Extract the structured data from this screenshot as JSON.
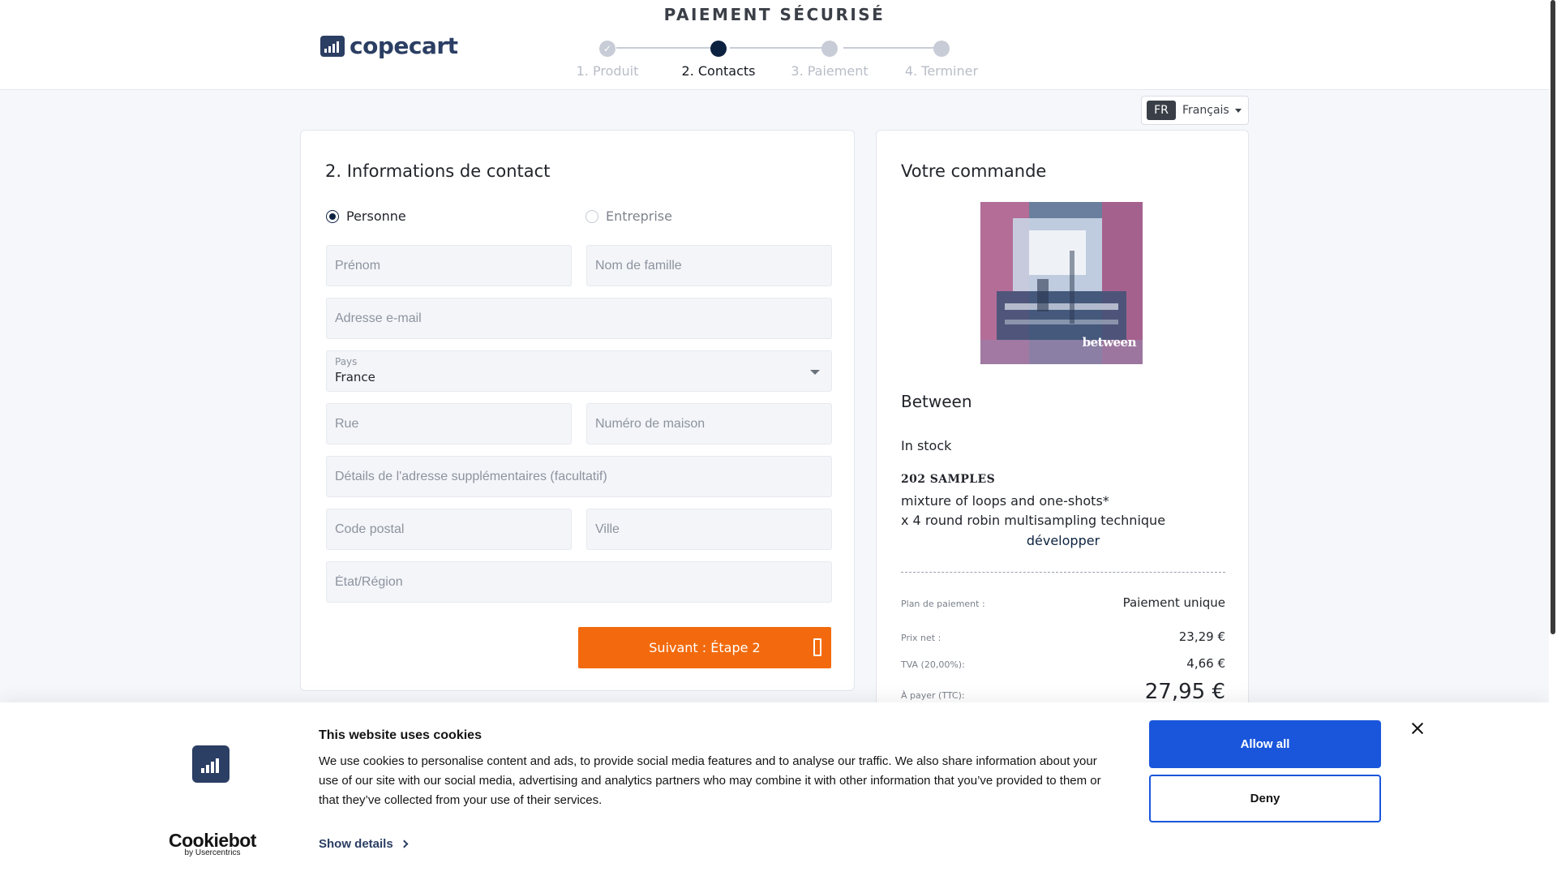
{
  "header": {
    "brand": "copecart",
    "secure_title": "PAIEMENT SÉCURISÉ",
    "steps": [
      {
        "label": "1. Produit",
        "state": "done"
      },
      {
        "label": "2. Contacts",
        "state": "active"
      },
      {
        "label": "3. Paiement",
        "state": "pending"
      },
      {
        "label": "4. Terminer",
        "state": "pending"
      }
    ]
  },
  "language": {
    "code": "FR",
    "name": "Français"
  },
  "contact": {
    "title": "2. Informations de contact",
    "radio_person": "Personne",
    "radio_company": "Entreprise",
    "selected": "Personne",
    "fields": {
      "first_name": {
        "placeholder": "Prénom",
        "value": ""
      },
      "last_name": {
        "placeholder": "Nom de famille",
        "value": ""
      },
      "email": {
        "placeholder": "Adresse e-mail",
        "value": ""
      },
      "street": {
        "placeholder": "Rue",
        "value": ""
      },
      "house_number": {
        "placeholder": "Numéro de maison",
        "value": ""
      },
      "address_extra": {
        "placeholder": "Détails de l'adresse supplémentaires (facultatif)",
        "value": ""
      },
      "postal_code": {
        "placeholder": "Code postal",
        "value": ""
      },
      "city": {
        "placeholder": "Ville",
        "value": ""
      },
      "state": {
        "placeholder": "État/Région",
        "value": ""
      }
    },
    "country": {
      "label": "Pays",
      "value": "France"
    },
    "next_button": "Suivant : Étape 2"
  },
  "order": {
    "title": "Votre commande",
    "product_image_text": "between",
    "product_name": "Between",
    "stock": "In stock",
    "samples": "202 SAMPLES",
    "desc_line1": "mixture of loops and one-shots*",
    "desc_line2": "x 4 round robin multisampling technique",
    "expand_link": "développer",
    "plan_label": "Plan de paiement :",
    "plan_value": "Paiement unique",
    "net_label": "Prix net :",
    "net_value": "23,29 €",
    "vat_label": "TVA (20,00%):",
    "vat_value": "4,66 €",
    "total_label": "À payer (TTC):",
    "total_value": "27,95 €"
  },
  "cookie": {
    "title": "This website uses cookies",
    "text": "We use cookies to personalise content and ads, to provide social media features and to analyse our traffic. We also share information about your use of our site with our social media, advertising and analytics partners who may combine it with other information that you’ve provided to them or that they’ve collected from your use of their services.",
    "show_details": "Show details",
    "allow_all": "Allow all",
    "deny": "Deny",
    "brand_name": "Cookiebot",
    "brand_sub": "by Usercentrics"
  },
  "colors": {
    "accent": "#f26a0d",
    "navy": "#0d2240",
    "cookie_blue": "#1a56db"
  }
}
